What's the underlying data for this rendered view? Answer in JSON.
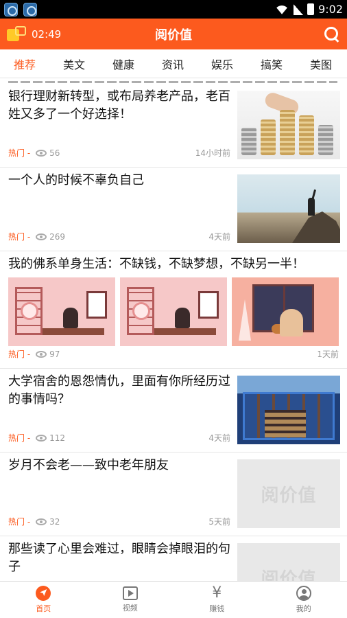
{
  "status_bar": {
    "time": "9:02"
  },
  "header": {
    "timer": "02:49",
    "title": "阅价值"
  },
  "tabs": [
    "推荐",
    "美文",
    "健康",
    "资讯",
    "娱乐",
    "搞笑",
    "美图"
  ],
  "feed": {
    "items": [
      {
        "title": "银行理财新转型，或布局养老产品，老百姓又多了一个好选择！",
        "hot": "热门 -",
        "views": "56",
        "time": "14小时前"
      },
      {
        "title": "一个人的时候不辜负自己",
        "hot": "热门 -",
        "views": "269",
        "time": "4天前"
      },
      {
        "title": "我的佛系单身生活：不缺钱，不缺梦想，不缺另一半！",
        "hot": "热门 -",
        "views": "97",
        "time": "1天前"
      },
      {
        "title": "大学宿舍的恩怨情仇，里面有你所经历过的事情吗？",
        "hot": "热门 -",
        "views": "112",
        "time": "4天前"
      },
      {
        "title": "岁月不会老——致中老年朋友",
        "hot": "热门 -",
        "views": "32",
        "time": "5天前"
      },
      {
        "title": "那些读了心里会难过，眼睛会掉眼泪的句子"
      }
    ],
    "placeholder_text": "阅价值"
  },
  "bottom_nav": [
    "首页",
    "视频",
    "赚钱",
    "我的"
  ],
  "colors": {
    "accent": "#fc5a1e"
  }
}
